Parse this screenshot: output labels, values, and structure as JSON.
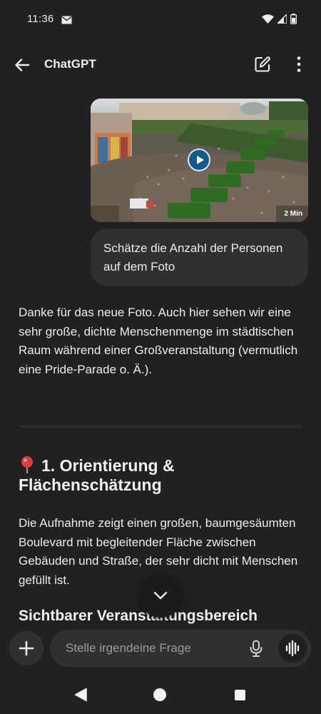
{
  "status_bar": {
    "time": "11:36",
    "icons": [
      "mail-icon",
      "wifi-icon",
      "signal-icon",
      "battery-icon"
    ]
  },
  "app_bar": {
    "title": "ChatGPT",
    "icons": [
      "back-arrow-icon",
      "edit-icon",
      "more-vertical-icon"
    ]
  },
  "messages": {
    "user_image": {
      "duration": "2 Min",
      "icon": "play-icon"
    },
    "user_text": "Schätze die Anzahl der Personen auf dem Foto",
    "assistant_intro": "Danke für das neue Foto. Auch hier sehen wir eine sehr große, dichte Menschenmenge im städtischen Raum während einer Großveranstaltung (vermutlich eine Pride-Parade o. Ä.).",
    "section_heading": "1. Orientierung & Flächenschätzung",
    "section_icon": "pin-icon",
    "section_text": "Die Aufnahme zeigt einen großen, baumgesäumten Boulevard mit begleitender Fläche zwischen Gebäuden und Straße, der sehr dicht mit Menschen gefüllt ist.",
    "sub_heading": "Sichtbarer Veranstaltungsbereich"
  },
  "composer": {
    "placeholder": "Stelle irgendeine Frage",
    "icons": [
      "plus-icon",
      "mic-icon",
      "voice-mode-icon"
    ]
  },
  "nav_bar": {
    "icons": [
      "nav-back-icon",
      "nav-home-icon",
      "nav-recents-icon"
    ]
  },
  "colors": {
    "background": "#212121",
    "bubble": "#303030",
    "text": "#ececec",
    "placeholder": "#9b9b9b",
    "play_button": "#0f5c8c"
  }
}
